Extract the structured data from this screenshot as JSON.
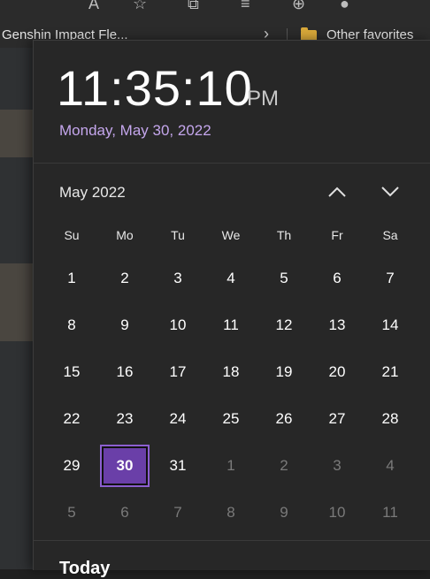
{
  "browser": {
    "favorites": [
      {
        "label": "Genshin Impact Fle..."
      },
      {
        "label": "Other favorites"
      }
    ]
  },
  "clock": {
    "time": "11:35:10",
    "ampm": "PM",
    "date": "Monday, May 30, 2022"
  },
  "calendar": {
    "month_label": "May 2022",
    "weekdays": [
      "Su",
      "Mo",
      "Tu",
      "We",
      "Th",
      "Fr",
      "Sa"
    ],
    "weeks": [
      [
        "1",
        "2",
        "3",
        "4",
        "5",
        "6",
        "7"
      ],
      [
        "8",
        "9",
        "10",
        "11",
        "12",
        "13",
        "14"
      ],
      [
        "15",
        "16",
        "17",
        "18",
        "19",
        "20",
        "21"
      ],
      [
        "22",
        "23",
        "24",
        "25",
        "26",
        "27",
        "28"
      ],
      [
        "29",
        "30",
        "31",
        "1",
        "2",
        "3",
        "4"
      ],
      [
        "5",
        "6",
        "7",
        "8",
        "9",
        "10",
        "11"
      ]
    ],
    "selected_day": "30"
  },
  "agenda": {
    "title": "Today"
  },
  "colors": {
    "accent": "#6a3fa8",
    "date_text": "#c4a6ec",
    "panel_bg": "#272727"
  }
}
